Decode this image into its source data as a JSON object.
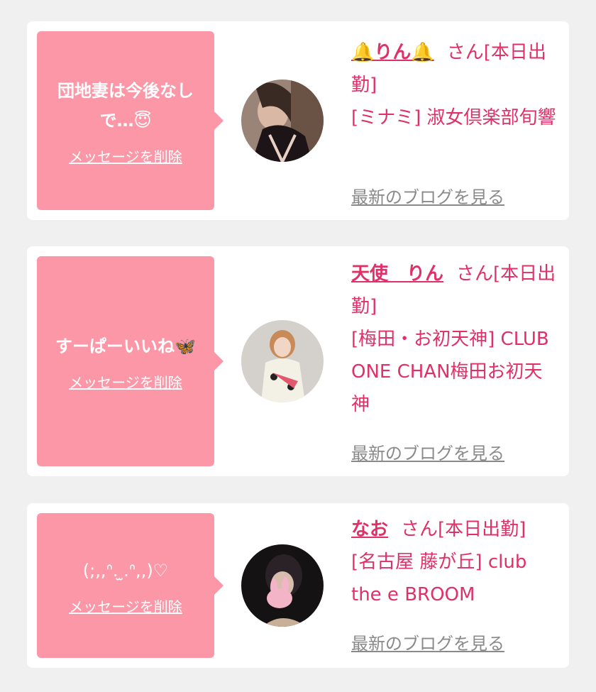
{
  "delete_label": "メッセージを削除",
  "blog_label": "最新のブログを見る",
  "colors": {
    "accent": "#e03068",
    "bubble": "#fc97a7",
    "background": "#f0f0f0"
  },
  "cards": [
    {
      "message": "団地妻は今後なしで…😇",
      "name": "🔔りん🔔",
      "status": "さん[本日出勤]",
      "shop": "[ミナミ] 淑女倶楽部旬響",
      "avatar_icon": "woman-photo-avatar"
    },
    {
      "message": "すーぱーいいね🦋",
      "name": "天使　りん",
      "status": "さん[本日出勤]",
      "shop": "[梅田・お初天神] CLUB ONE CHAN梅田お初天神",
      "avatar_icon": "woman-photo-avatar"
    },
    {
      "message": "(;,,ᐢ. ̫.ᐢ,,)♡",
      "name": "なお",
      "status": "さん[本日出勤]",
      "shop": "[名古屋 藤が丘] club the e BROOM",
      "avatar_icon": "woman-photo-avatar"
    }
  ]
}
